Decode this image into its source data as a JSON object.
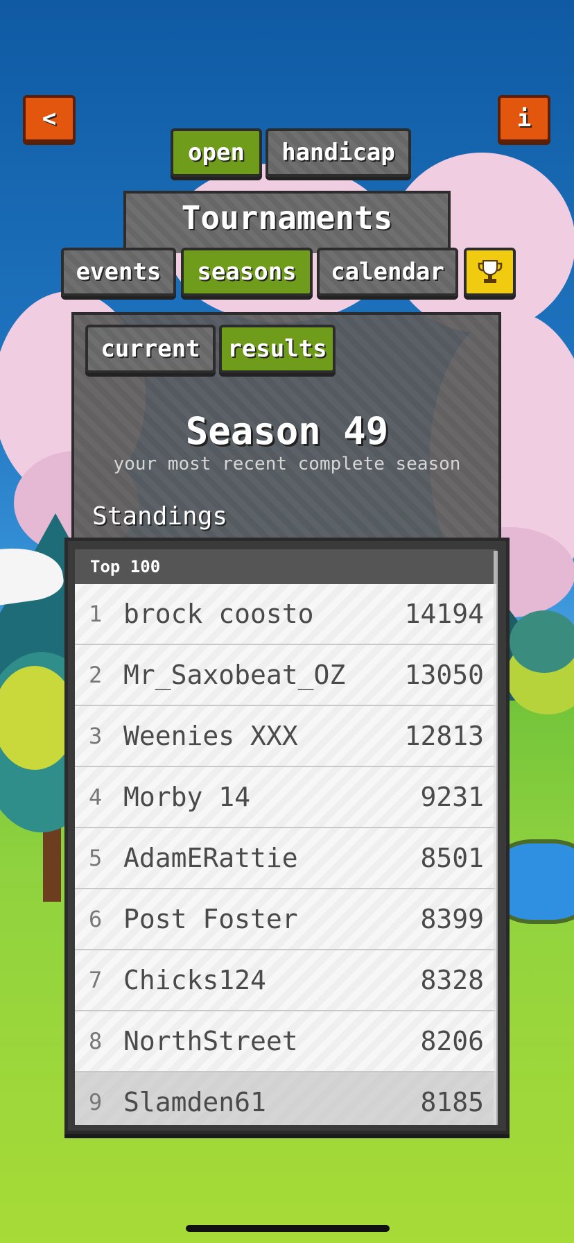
{
  "nav": {
    "back_icon_char": "<",
    "info_icon_char": "i"
  },
  "mode_tabs": [
    "open",
    "handicap"
  ],
  "header": {
    "title": "Tournaments"
  },
  "section_tabs": [
    "events",
    "seasons",
    "calendar"
  ],
  "trophy_icon": "trophy-icon",
  "sub_tabs": [
    "current",
    "results"
  ],
  "season": {
    "title": "Season 49",
    "subtitle": "your most recent complete season",
    "standings_label": "Standings"
  },
  "leaderboard": {
    "header": "Top 100",
    "rows": [
      {
        "rank": "1",
        "name": "brock coosto",
        "score": "14194"
      },
      {
        "rank": "2",
        "name": "Mr_Saxobeat_OZ",
        "score": "13050"
      },
      {
        "rank": "3",
        "name": "Weenies XXX",
        "score": "12813"
      },
      {
        "rank": "4",
        "name": "Morby 14",
        "score": "9231"
      },
      {
        "rank": "5",
        "name": "AdamERattie",
        "score": "8501"
      },
      {
        "rank": "6",
        "name": "Post Foster",
        "score": "8399"
      },
      {
        "rank": "7",
        "name": "Chicks124",
        "score": "8328"
      },
      {
        "rank": "8",
        "name": "NorthStreet",
        "score": "8206"
      },
      {
        "rank": "9",
        "name": "Slamden61",
        "score": "8185"
      }
    ]
  },
  "colors": {
    "active_tab": "#6f9c1a",
    "inactive_tab": "#6f6f6f",
    "nav_button": "#e2560e",
    "trophy_button": "#f1cb0f"
  }
}
